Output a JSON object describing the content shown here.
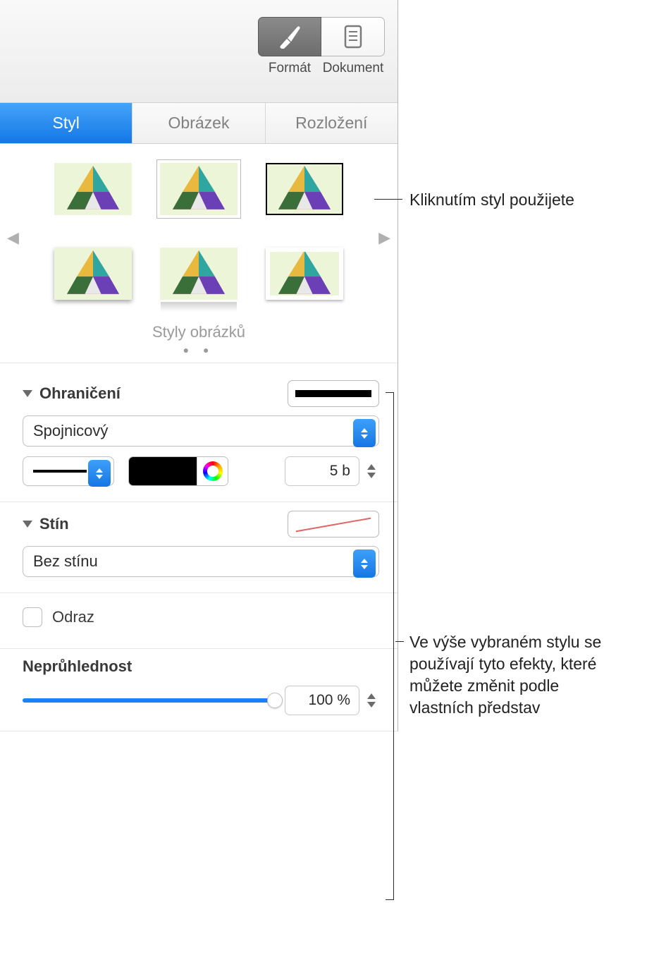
{
  "toolbar": {
    "format_label": "Formát",
    "document_label": "Dokument",
    "active": "format"
  },
  "tabs": {
    "style": "Styl",
    "image": "Obrázek",
    "layout": "Rozložení",
    "active": "style"
  },
  "gallery": {
    "title": "Styly obrázků",
    "page_dots": 2,
    "items": 6,
    "selected_index": 1
  },
  "border": {
    "title": "Ohraničení",
    "line_type": "Spojnicový",
    "color": "#000000",
    "width_value": "5 b"
  },
  "shadow": {
    "title": "Stín",
    "type": "Bez stínu",
    "swatch": "none"
  },
  "reflection": {
    "label": "Odraz",
    "checked": false
  },
  "opacity": {
    "label": "Neprůhlednost",
    "value_text": "100 %",
    "percent": 100
  },
  "callouts": {
    "apply_style": "Kliknutím styl použijete",
    "effects_note": "Ve výše vybraném stylu se používají tyto efekty, které můžete změnit podle vlastních představ"
  }
}
